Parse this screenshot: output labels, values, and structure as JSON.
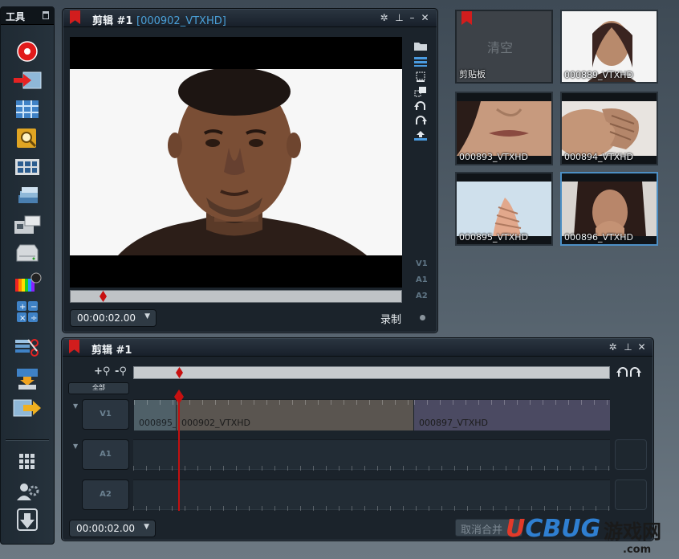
{
  "toolbar": {
    "title": "工具",
    "tools": [
      {
        "name": "record-icon"
      },
      {
        "name": "import-icon"
      },
      {
        "name": "storyboard-icon"
      },
      {
        "name": "search-media-icon"
      },
      {
        "name": "grid-view-icon"
      },
      {
        "name": "stack-icon"
      },
      {
        "name": "capture-device-icon"
      },
      {
        "name": "drive-icon"
      },
      {
        "name": "color-bars-icon"
      },
      {
        "name": "calculator-icon"
      },
      {
        "name": "cut-icon"
      },
      {
        "name": "film-export-icon"
      },
      {
        "name": "export-arrow-icon"
      },
      {
        "name": "keypad-icon"
      },
      {
        "name": "users-settings-icon"
      },
      {
        "name": "download-icon"
      }
    ]
  },
  "viewer": {
    "title": "剪辑 #1",
    "clip_id": "[000902_VTXHD]",
    "timecode": "00:00:02.00",
    "record_label": "录制",
    "track_labels": [
      "V1",
      "A1",
      "A2"
    ]
  },
  "clips": {
    "clipboard_label": "剪贴板",
    "clear_label": "清空",
    "items": [
      {
        "name": "000889_VTXHD"
      },
      {
        "name": "000893_VTXHD"
      },
      {
        "name": "000894_VTXHD"
      },
      {
        "name": "000895_VTXHD"
      },
      {
        "name": "000896_VTXHD"
      }
    ]
  },
  "timeline": {
    "title": "剪辑 #1",
    "all_label": "全部",
    "tracks": [
      "V1",
      "A1",
      "A2"
    ],
    "v1_clips": [
      "000895_",
      "000902_VTXHD",
      "000897_VTXHD"
    ],
    "timecode": "00:00:02.00",
    "ungroup_label": "取消合并"
  },
  "watermark": {
    "brand": "UCBUG",
    "cn": "游戏网",
    "domain": ".com"
  },
  "colors": {
    "accent_red": "#c81010",
    "accent_blue": "#4aa0d8"
  }
}
